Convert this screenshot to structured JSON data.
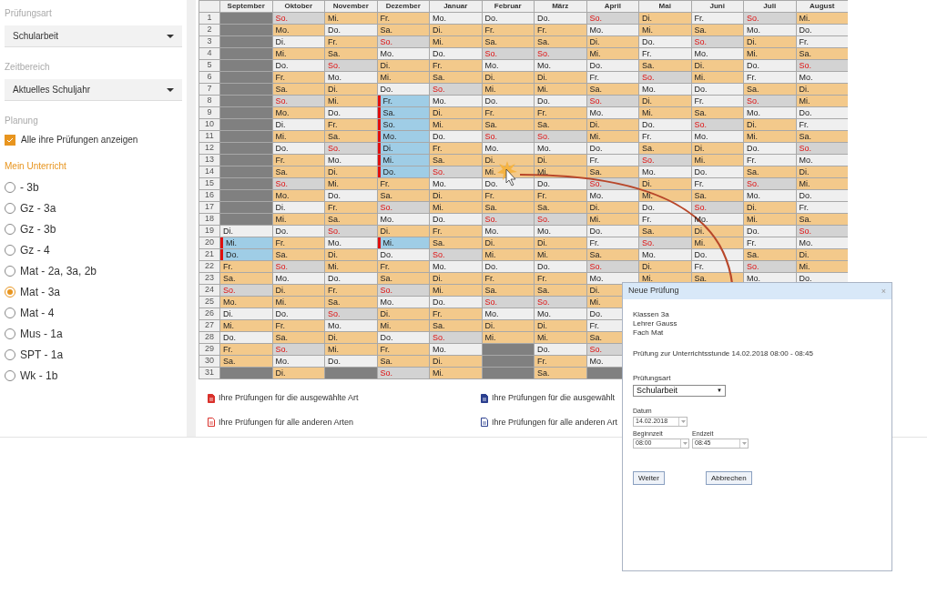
{
  "sidebar": {
    "sections": [
      {
        "label": "Prüfungsart",
        "kind": "select",
        "value": "Schularbeit"
      },
      {
        "label": "Zeitbereich",
        "kind": "select",
        "value": "Aktuelles Schuljahr"
      },
      {
        "label": "Planung",
        "kind": "checkbox",
        "value": "Alle ihre Prüfungen anzeigen",
        "checked": true
      }
    ],
    "courses_title": "Mein Unterricht",
    "courses": [
      {
        "label": "- 3b",
        "selected": false
      },
      {
        "label": "Gz - 3a",
        "selected": false
      },
      {
        "label": "Gz - 3b",
        "selected": false
      },
      {
        "label": "Gz - 4",
        "selected": false
      },
      {
        "label": "Mat - 2a, 3a, 2b",
        "selected": false
      },
      {
        "label": "Mat - 3a",
        "selected": true
      },
      {
        "label": "Mat - 4",
        "selected": false
      },
      {
        "label": "Mus - 1a",
        "selected": false
      },
      {
        "label": "SPT - 1a",
        "selected": false
      },
      {
        "label": "Wk - 1b",
        "selected": false
      }
    ]
  },
  "calendar": {
    "row_numbers": [
      "1",
      "2",
      "3",
      "4",
      "5",
      "6",
      "7",
      "8",
      "9",
      "10",
      "11",
      "12",
      "13",
      "14",
      "15",
      "16",
      "17",
      "18",
      "19",
      "20",
      "21",
      "22",
      "23",
      "24",
      "25",
      "26",
      "27",
      "28",
      "29",
      "30",
      "31"
    ],
    "months": [
      {
        "name": "September",
        "days": [
          {
            "kind": "blocked"
          },
          {
            "kind": "blocked"
          },
          {
            "kind": "blocked"
          },
          {
            "kind": "blocked"
          },
          {
            "kind": "blocked"
          },
          {
            "kind": "blocked"
          },
          {
            "kind": "blocked"
          },
          {
            "kind": "blocked"
          },
          {
            "kind": "blocked"
          },
          {
            "kind": "blocked"
          },
          {
            "kind": "blocked"
          },
          {
            "kind": "blocked"
          },
          {
            "kind": "blocked"
          },
          {
            "kind": "blocked"
          },
          {
            "kind": "blocked"
          },
          {
            "kind": "blocked"
          },
          {
            "kind": "blocked"
          },
          {
            "kind": "blocked"
          },
          {
            "day": "Di.",
            "kind": "free"
          },
          {
            "day": "Mi.",
            "kind": "exam"
          },
          {
            "day": "Do.",
            "kind": "exam"
          },
          {
            "day": "Fr.",
            "kind": "lesson"
          },
          {
            "day": "Sa.",
            "kind": "lesson"
          },
          {
            "day": "So.",
            "kind": "sunday"
          },
          {
            "day": "Mo.",
            "kind": "lesson"
          },
          {
            "day": "Di.",
            "kind": "free"
          },
          {
            "day": "Mi.",
            "kind": "lesson"
          },
          {
            "day": "Do.",
            "kind": "free"
          },
          {
            "day": "Fr.",
            "kind": "lesson"
          },
          {
            "day": "Sa.",
            "kind": "lesson"
          },
          {
            "kind": "blocked"
          }
        ]
      },
      {
        "name": "Oktober",
        "days": [
          {
            "day": "So.",
            "kind": "sunday"
          },
          {
            "day": "Mo.",
            "kind": "lesson"
          },
          {
            "day": "Di.",
            "kind": "free"
          },
          {
            "day": "Mi.",
            "kind": "lesson"
          },
          {
            "day": "Do.",
            "kind": "free"
          },
          {
            "day": "Fr.",
            "kind": "lesson"
          },
          {
            "day": "Sa.",
            "kind": "lesson"
          },
          {
            "day": "So.",
            "kind": "sunday"
          },
          {
            "day": "Mo.",
            "kind": "lesson"
          },
          {
            "day": "Di.",
            "kind": "free"
          },
          {
            "day": "Mi.",
            "kind": "lesson"
          },
          {
            "day": "Do.",
            "kind": "free"
          },
          {
            "day": "Fr.",
            "kind": "lesson"
          },
          {
            "day": "Sa.",
            "kind": "lesson"
          },
          {
            "day": "So.",
            "kind": "sunday"
          },
          {
            "day": "Mo.",
            "kind": "lesson"
          },
          {
            "day": "Di.",
            "kind": "free"
          },
          {
            "day": "Mi.",
            "kind": "lesson"
          },
          {
            "day": "Do.",
            "kind": "free"
          },
          {
            "day": "Fr.",
            "kind": "lesson"
          },
          {
            "day": "Sa.",
            "kind": "lesson"
          },
          {
            "day": "So.",
            "kind": "sunday"
          },
          {
            "day": "Mo.",
            "kind": "free"
          },
          {
            "day": "Di.",
            "kind": "lesson"
          },
          {
            "day": "Mi.",
            "kind": "lesson"
          },
          {
            "day": "Do.",
            "kind": "free"
          },
          {
            "day": "Fr.",
            "kind": "lesson"
          },
          {
            "day": "Sa.",
            "kind": "lesson"
          },
          {
            "day": "So.",
            "kind": "sunday"
          },
          {
            "day": "Mo.",
            "kind": "free"
          },
          {
            "day": "Di.",
            "kind": "lesson"
          }
        ]
      },
      {
        "name": "November",
        "days": [
          {
            "day": "Mi.",
            "kind": "lesson"
          },
          {
            "day": "Do.",
            "kind": "free"
          },
          {
            "day": "Fr.",
            "kind": "lesson"
          },
          {
            "day": "Sa.",
            "kind": "lesson"
          },
          {
            "day": "So.",
            "kind": "sunday"
          },
          {
            "day": "Mo.",
            "kind": "free"
          },
          {
            "day": "Di.",
            "kind": "lesson"
          },
          {
            "day": "Mi.",
            "kind": "lesson"
          },
          {
            "day": "Do.",
            "kind": "free"
          },
          {
            "day": "Fr.",
            "kind": "lesson"
          },
          {
            "day": "Sa.",
            "kind": "lesson"
          },
          {
            "day": "So.",
            "kind": "sunday"
          },
          {
            "day": "Mo.",
            "kind": "free"
          },
          {
            "day": "Di.",
            "kind": "lesson"
          },
          {
            "day": "Mi.",
            "kind": "lesson"
          },
          {
            "day": "Do.",
            "kind": "free"
          },
          {
            "day": "Fr.",
            "kind": "lesson"
          },
          {
            "day": "Sa.",
            "kind": "lesson"
          },
          {
            "day": "So.",
            "kind": "sunday"
          },
          {
            "day": "Mo.",
            "kind": "free"
          },
          {
            "day": "Di.",
            "kind": "lesson"
          },
          {
            "day": "Mi.",
            "kind": "lesson"
          },
          {
            "day": "Do.",
            "kind": "free"
          },
          {
            "day": "Fr.",
            "kind": "lesson"
          },
          {
            "day": "Sa.",
            "kind": "lesson"
          },
          {
            "day": "So.",
            "kind": "sunday"
          },
          {
            "day": "Mo.",
            "kind": "free"
          },
          {
            "day": "Di.",
            "kind": "lesson"
          },
          {
            "day": "Mi.",
            "kind": "lesson"
          },
          {
            "day": "Do.",
            "kind": "free"
          },
          {
            "kind": "blocked"
          }
        ]
      },
      {
        "name": "Dezember",
        "days": [
          {
            "day": "Fr.",
            "kind": "lesson"
          },
          {
            "day": "Sa.",
            "kind": "lesson"
          },
          {
            "day": "So.",
            "kind": "sunday"
          },
          {
            "day": "Mo.",
            "kind": "free"
          },
          {
            "day": "Di.",
            "kind": "lesson"
          },
          {
            "day": "Mi.",
            "kind": "lesson"
          },
          {
            "day": "Do.",
            "kind": "free"
          },
          {
            "day": "Fr.",
            "kind": "exam"
          },
          {
            "day": "Sa.",
            "kind": "exam"
          },
          {
            "day": "So.",
            "kind": "exam"
          },
          {
            "day": "Mo.",
            "kind": "exam"
          },
          {
            "day": "Di.",
            "kind": "exam"
          },
          {
            "day": "Mi.",
            "kind": "exam"
          },
          {
            "day": "Do.",
            "kind": "exam"
          },
          {
            "day": "Fr.",
            "kind": "lesson"
          },
          {
            "day": "Sa.",
            "kind": "lesson"
          },
          {
            "day": "So.",
            "kind": "sunday"
          },
          {
            "day": "Mo.",
            "kind": "free"
          },
          {
            "day": "Di.",
            "kind": "lesson"
          },
          {
            "day": "Mi.",
            "kind": "exam"
          },
          {
            "day": "Do.",
            "kind": "free"
          },
          {
            "day": "Fr.",
            "kind": "lesson"
          },
          {
            "day": "Sa.",
            "kind": "lesson"
          },
          {
            "day": "So.",
            "kind": "sunday"
          },
          {
            "day": "Mo.",
            "kind": "free"
          },
          {
            "day": "Di.",
            "kind": "lesson"
          },
          {
            "day": "Mi.",
            "kind": "lesson"
          },
          {
            "day": "Do.",
            "kind": "free"
          },
          {
            "day": "Fr.",
            "kind": "lesson"
          },
          {
            "day": "Sa.",
            "kind": "lesson"
          },
          {
            "day": "So.",
            "kind": "sunday"
          }
        ]
      },
      {
        "name": "Januar",
        "days": [
          {
            "day": "Mo.",
            "kind": "free"
          },
          {
            "day": "Di.",
            "kind": "lesson"
          },
          {
            "day": "Mi.",
            "kind": "lesson"
          },
          {
            "day": "Do.",
            "kind": "free"
          },
          {
            "day": "Fr.",
            "kind": "lesson"
          },
          {
            "day": "Sa.",
            "kind": "lesson"
          },
          {
            "day": "So.",
            "kind": "sunday"
          },
          {
            "day": "Mo.",
            "kind": "free"
          },
          {
            "day": "Di.",
            "kind": "lesson"
          },
          {
            "day": "Mi.",
            "kind": "lesson"
          },
          {
            "day": "Do.",
            "kind": "free"
          },
          {
            "day": "Fr.",
            "kind": "lesson"
          },
          {
            "day": "Sa.",
            "kind": "lesson"
          },
          {
            "day": "So.",
            "kind": "sunday"
          },
          {
            "day": "Mo.",
            "kind": "free"
          },
          {
            "day": "Di.",
            "kind": "lesson"
          },
          {
            "day": "Mi.",
            "kind": "lesson"
          },
          {
            "day": "Do.",
            "kind": "free"
          },
          {
            "day": "Fr.",
            "kind": "lesson"
          },
          {
            "day": "Sa.",
            "kind": "lesson"
          },
          {
            "day": "So.",
            "kind": "sunday"
          },
          {
            "day": "Mo.",
            "kind": "free"
          },
          {
            "day": "Di.",
            "kind": "lesson"
          },
          {
            "day": "Mi.",
            "kind": "lesson"
          },
          {
            "day": "Do.",
            "kind": "free"
          },
          {
            "day": "Fr.",
            "kind": "lesson"
          },
          {
            "day": "Sa.",
            "kind": "lesson"
          },
          {
            "day": "So.",
            "kind": "sunday"
          },
          {
            "day": "Mo.",
            "kind": "free"
          },
          {
            "day": "Di.",
            "kind": "lesson"
          },
          {
            "day": "Mi.",
            "kind": "lesson"
          }
        ]
      },
      {
        "name": "Februar",
        "days": [
          {
            "day": "Do.",
            "kind": "free"
          },
          {
            "day": "Fr.",
            "kind": "lesson"
          },
          {
            "day": "Sa.",
            "kind": "lesson"
          },
          {
            "day": "So.",
            "kind": "sunday"
          },
          {
            "day": "Mo.",
            "kind": "free"
          },
          {
            "day": "Di.",
            "kind": "lesson"
          },
          {
            "day": "Mi.",
            "kind": "lesson"
          },
          {
            "day": "Do.",
            "kind": "free"
          },
          {
            "day": "Fr.",
            "kind": "lesson"
          },
          {
            "day": "Sa.",
            "kind": "lesson"
          },
          {
            "day": "So.",
            "kind": "sunday"
          },
          {
            "day": "Mo.",
            "kind": "free"
          },
          {
            "day": "Di.",
            "kind": "lesson"
          },
          {
            "day": "Mi.",
            "kind": "lesson"
          },
          {
            "day": "Do.",
            "kind": "free"
          },
          {
            "day": "Fr.",
            "kind": "lesson"
          },
          {
            "day": "Sa.",
            "kind": "lesson"
          },
          {
            "day": "So.",
            "kind": "sunday"
          },
          {
            "day": "Mo.",
            "kind": "free"
          },
          {
            "day": "Di.",
            "kind": "lesson"
          },
          {
            "day": "Mi.",
            "kind": "lesson"
          },
          {
            "day": "Do.",
            "kind": "free"
          },
          {
            "day": "Fr.",
            "kind": "lesson"
          },
          {
            "day": "Sa.",
            "kind": "lesson"
          },
          {
            "day": "So.",
            "kind": "sunday"
          },
          {
            "day": "Mo.",
            "kind": "free"
          },
          {
            "day": "Di.",
            "kind": "lesson"
          },
          {
            "day": "Mi.",
            "kind": "lesson"
          },
          {
            "kind": "blocked"
          },
          {
            "kind": "blocked"
          },
          {
            "kind": "blocked"
          }
        ]
      },
      {
        "name": "März",
        "days": [
          {
            "day": "Do.",
            "kind": "free"
          },
          {
            "day": "Fr.",
            "kind": "lesson"
          },
          {
            "day": "Sa.",
            "kind": "lesson"
          },
          {
            "day": "So.",
            "kind": "sunday"
          },
          {
            "day": "Mo.",
            "kind": "free"
          },
          {
            "day": "Di.",
            "kind": "lesson"
          },
          {
            "day": "Mi.",
            "kind": "lesson"
          },
          {
            "day": "Do.",
            "kind": "free"
          },
          {
            "day": "Fr.",
            "kind": "lesson"
          },
          {
            "day": "Sa.",
            "kind": "lesson"
          },
          {
            "day": "So.",
            "kind": "sunday"
          },
          {
            "day": "Mo.",
            "kind": "free"
          },
          {
            "day": "Di.",
            "kind": "lesson"
          },
          {
            "day": "Mi.",
            "kind": "lesson"
          },
          {
            "day": "Do.",
            "kind": "free"
          },
          {
            "day": "Fr.",
            "kind": "lesson"
          },
          {
            "day": "Sa.",
            "kind": "lesson"
          },
          {
            "day": "So.",
            "kind": "sunday"
          },
          {
            "day": "Mo.",
            "kind": "free"
          },
          {
            "day": "Di.",
            "kind": "lesson"
          },
          {
            "day": "Mi.",
            "kind": "lesson"
          },
          {
            "day": "Do.",
            "kind": "free"
          },
          {
            "day": "Fr.",
            "kind": "lesson"
          },
          {
            "day": "Sa.",
            "kind": "lesson"
          },
          {
            "day": "So.",
            "kind": "sunday"
          },
          {
            "day": "Mo.",
            "kind": "free"
          },
          {
            "day": "Di.",
            "kind": "lesson"
          },
          {
            "day": "Mi.",
            "kind": "lesson"
          },
          {
            "day": "Do.",
            "kind": "free"
          },
          {
            "day": "Fr.",
            "kind": "lesson"
          },
          {
            "day": "Sa.",
            "kind": "lesson"
          }
        ]
      },
      {
        "name": "April",
        "days": [
          {
            "day": "So.",
            "kind": "sunday"
          },
          {
            "day": "Mo.",
            "kind": "free"
          },
          {
            "day": "Di.",
            "kind": "lesson"
          },
          {
            "day": "Mi.",
            "kind": "lesson"
          },
          {
            "day": "Do.",
            "kind": "free"
          },
          {
            "day": "Fr.",
            "kind": "free"
          },
          {
            "day": "Sa.",
            "kind": "lesson"
          },
          {
            "day": "So.",
            "kind": "sunday"
          },
          {
            "day": "Mo.",
            "kind": "free"
          },
          {
            "day": "Di.",
            "kind": "lesson"
          },
          {
            "day": "Mi.",
            "kind": "lesson"
          },
          {
            "day": "Do.",
            "kind": "free"
          },
          {
            "day": "Fr.",
            "kind": "free"
          },
          {
            "day": "Sa.",
            "kind": "lesson"
          },
          {
            "day": "So.",
            "kind": "sunday"
          },
          {
            "day": "Mo.",
            "kind": "free"
          },
          {
            "day": "Di.",
            "kind": "lesson"
          },
          {
            "day": "Mi.",
            "kind": "lesson"
          },
          {
            "day": "Do.",
            "kind": "free"
          },
          {
            "day": "Fr.",
            "kind": "free"
          },
          {
            "day": "Sa.",
            "kind": "lesson"
          },
          {
            "day": "So.",
            "kind": "sunday"
          },
          {
            "day": "Mo.",
            "kind": "free"
          },
          {
            "day": "Di.",
            "kind": "lesson"
          },
          {
            "day": "Mi.",
            "kind": "lesson"
          },
          {
            "day": "Do.",
            "kind": "free"
          },
          {
            "day": "Fr.",
            "kind": "free"
          },
          {
            "day": "Sa.",
            "kind": "lesson"
          },
          {
            "day": "So.",
            "kind": "sunday"
          },
          {
            "day": "Mo.",
            "kind": "free"
          },
          {
            "kind": "blocked"
          }
        ]
      },
      {
        "name": "Mai",
        "days": [
          {
            "day": "Di.",
            "kind": "lesson"
          },
          {
            "day": "Mi.",
            "kind": "lesson"
          },
          {
            "day": "Do.",
            "kind": "free"
          },
          {
            "day": "Fr.",
            "kind": "free"
          },
          {
            "day": "Sa.",
            "kind": "lesson"
          },
          {
            "day": "So.",
            "kind": "sunday"
          },
          {
            "day": "Mo.",
            "kind": "free"
          },
          {
            "day": "Di.",
            "kind": "lesson"
          },
          {
            "day": "Mi.",
            "kind": "lesson"
          },
          {
            "day": "Do.",
            "kind": "free"
          },
          {
            "day": "Fr.",
            "kind": "free"
          },
          {
            "day": "Sa.",
            "kind": "lesson"
          },
          {
            "day": "So.",
            "kind": "sunday"
          },
          {
            "day": "Mo.",
            "kind": "free"
          },
          {
            "day": "Di.",
            "kind": "lesson"
          },
          {
            "day": "Mi.",
            "kind": "lesson"
          },
          {
            "day": "Do.",
            "kind": "free"
          },
          {
            "day": "Fr.",
            "kind": "free"
          },
          {
            "day": "Sa.",
            "kind": "lesson"
          },
          {
            "day": "So.",
            "kind": "sunday"
          },
          {
            "day": "Mo.",
            "kind": "free"
          },
          {
            "day": "Di.",
            "kind": "lesson"
          },
          {
            "day": "Mi.",
            "kind": "lesson"
          }
        ]
      },
      {
        "name": "Juni",
        "days": [
          {
            "day": "Fr.",
            "kind": "free"
          },
          {
            "day": "Sa.",
            "kind": "lesson"
          },
          {
            "day": "So.",
            "kind": "sunday"
          },
          {
            "day": "Mo.",
            "kind": "free"
          },
          {
            "day": "Di.",
            "kind": "lesson"
          },
          {
            "day": "Mi.",
            "kind": "lesson"
          },
          {
            "day": "Do.",
            "kind": "free"
          },
          {
            "day": "Fr.",
            "kind": "free"
          },
          {
            "day": "Sa.",
            "kind": "lesson"
          },
          {
            "day": "So.",
            "kind": "sunday"
          },
          {
            "day": "Mo.",
            "kind": "free"
          },
          {
            "day": "Di.",
            "kind": "lesson"
          },
          {
            "day": "Mi.",
            "kind": "lesson"
          },
          {
            "day": "Do.",
            "kind": "free"
          },
          {
            "day": "Fr.",
            "kind": "free"
          },
          {
            "day": "Sa.",
            "kind": "lesson"
          },
          {
            "day": "So.",
            "kind": "sunday"
          },
          {
            "day": "Mo.",
            "kind": "free"
          },
          {
            "day": "Di.",
            "kind": "lesson"
          },
          {
            "day": "Mi.",
            "kind": "lesson"
          },
          {
            "day": "Do.",
            "kind": "free"
          },
          {
            "day": "Fr.",
            "kind": "free"
          },
          {
            "day": "Sa.",
            "kind": "lesson"
          }
        ]
      },
      {
        "name": "Juli",
        "days": [
          {
            "day": "So.",
            "kind": "sunday"
          },
          {
            "day": "Mo.",
            "kind": "free"
          },
          {
            "day": "Di.",
            "kind": "lesson"
          },
          {
            "day": "Mi.",
            "kind": "lesson"
          },
          {
            "day": "Do.",
            "kind": "free"
          },
          {
            "day": "Fr.",
            "kind": "free"
          },
          {
            "day": "Sa.",
            "kind": "lesson"
          },
          {
            "day": "So.",
            "kind": "sunday"
          },
          {
            "day": "Mo.",
            "kind": "free"
          },
          {
            "day": "Di.",
            "kind": "lesson"
          },
          {
            "day": "Mi.",
            "kind": "lesson"
          },
          {
            "day": "Do.",
            "kind": "free"
          },
          {
            "day": "Fr.",
            "kind": "free"
          },
          {
            "day": "Sa.",
            "kind": "lesson"
          },
          {
            "day": "So.",
            "kind": "sunday"
          },
          {
            "day": "Mo.",
            "kind": "free"
          },
          {
            "day": "Di.",
            "kind": "lesson"
          },
          {
            "day": "Mi.",
            "kind": "lesson"
          },
          {
            "day": "Do.",
            "kind": "free"
          },
          {
            "day": "Fr.",
            "kind": "free"
          },
          {
            "day": "Sa.",
            "kind": "lesson"
          },
          {
            "day": "So.",
            "kind": "sunday"
          },
          {
            "day": "Mo.",
            "kind": "free"
          }
        ]
      },
      {
        "name": "August",
        "days": [
          {
            "day": "Mi.",
            "kind": "lesson"
          },
          {
            "day": "Do.",
            "kind": "free"
          },
          {
            "day": "Fr.",
            "kind": "free"
          },
          {
            "day": "Sa.",
            "kind": "lesson"
          },
          {
            "day": "So.",
            "kind": "sunday"
          },
          {
            "day": "Mo.",
            "kind": "free"
          },
          {
            "day": "Di.",
            "kind": "lesson"
          },
          {
            "day": "Mi.",
            "kind": "lesson"
          },
          {
            "day": "Do.",
            "kind": "free"
          },
          {
            "day": "Fr.",
            "kind": "free"
          },
          {
            "day": "Sa.",
            "kind": "lesson"
          },
          {
            "day": "So.",
            "kind": "sunday"
          },
          {
            "day": "Mo.",
            "kind": "free"
          },
          {
            "day": "Di.",
            "kind": "lesson"
          },
          {
            "day": "Mi.",
            "kind": "lesson"
          },
          {
            "day": "Do.",
            "kind": "free"
          },
          {
            "day": "Fr.",
            "kind": "free"
          },
          {
            "day": "Sa.",
            "kind": "lesson"
          },
          {
            "day": "So.",
            "kind": "sunday"
          },
          {
            "day": "Mo.",
            "kind": "free"
          },
          {
            "day": "Di.",
            "kind": "lesson"
          },
          {
            "day": "Mi.",
            "kind": "lesson"
          },
          {
            "day": "Do.",
            "kind": "free"
          }
        ]
      }
    ]
  },
  "legend": [
    {
      "label": "Ihre Prüfungen für die ausgewählte Art",
      "color": "#d9312b",
      "filled": true
    },
    {
      "label": "Ihre Prüfungen für die ausgewählt",
      "color": "#2b3f8f",
      "filled": true
    },
    {
      "label": "Ihre Prüfungen für alle anderen Arten",
      "color": "#d9312b",
      "filled": false
    },
    {
      "label": "Ihre Prüfungen für alle anderen Art",
      "color": "#2b3f8f",
      "filled": false
    }
  ],
  "dialog": {
    "title": "Neue Prüfung",
    "close": "×",
    "info": [
      "Klassen 3a",
      "Lehrer Gauss",
      "Fach Mat"
    ],
    "lesson": "Prüfung zur Unterrichtsstunde 14.02.2018 08:00 - 08:45",
    "type_label": "Prüfungsart",
    "type_value": "Schularbeit",
    "type_caret": "▼",
    "date_label": "Datum",
    "date_value": "14.02.2018",
    "start_label": "Beginnzeit",
    "start_value": "08:00",
    "end_label": "Endzeit",
    "end_value": "08:45",
    "buttons": [
      "Weiter",
      "Abbrechen"
    ]
  }
}
